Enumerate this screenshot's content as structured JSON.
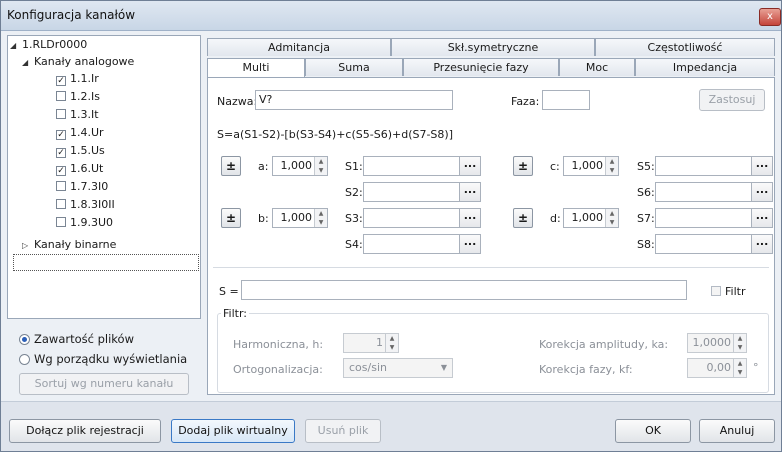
{
  "window": {
    "title": "Konfiguracja kanałów",
    "close": "x"
  },
  "tree": {
    "root": "1.RLDr0000",
    "group_analog": "Kanały analogowe",
    "channels": [
      {
        "label": "1.1.Ir",
        "checked": true
      },
      {
        "label": "1.2.Is",
        "checked": false
      },
      {
        "label": "1.3.It",
        "checked": false
      },
      {
        "label": "1.4.Ur",
        "checked": true
      },
      {
        "label": "1.5.Us",
        "checked": true
      },
      {
        "label": "1.6.Ut",
        "checked": true
      },
      {
        "label": "1.7.3I0",
        "checked": false
      },
      {
        "label": "1.8.3I0II",
        "checked": false
      },
      {
        "label": "1.9.3U0",
        "checked": false
      }
    ],
    "group_binary": "Kanały binarne"
  },
  "sort": {
    "radio1": "Zawartość plików",
    "radio2": "Wg porządku wyświetlania",
    "selected": 1,
    "sort_button": "Sortuj wg numeru kanału"
  },
  "tabs": {
    "row1": [
      "Admitancja",
      "Skł.symetryczne",
      "Częstotliwość"
    ],
    "row2": [
      "Multi",
      "Suma",
      "Przesunięcie fazy",
      "Moc",
      "Impedancja"
    ],
    "active": "Multi"
  },
  "multi": {
    "name_label": "Nazwa:",
    "name_value": "V?",
    "phase_label": "Faza:",
    "phase_value": "",
    "apply_button": "Zastosuj",
    "formula": "S=a(S1-S2)-[b(S3-S4)+c(S5-S6)+d(S7-S8)]",
    "pm_symbol": "±",
    "coef_a_label": "a:",
    "coef_a_value": "1,000",
    "coef_b_label": "b:",
    "coef_b_value": "1,000",
    "coef_c_label": "c:",
    "coef_c_value": "1,000",
    "coef_d_label": "d:",
    "coef_d_value": "1,000",
    "slots": [
      "S1:",
      "S2:",
      "S3:",
      "S4:",
      "S5:",
      "S6:",
      "S7:",
      "S8:"
    ],
    "dots": "...",
    "s_label": "S =",
    "s_value": "",
    "filter_check": "Filtr",
    "filter_group": "Filtr:",
    "harm_label": "Harmoniczna, h:",
    "harm_value": "1",
    "orth_label": "Ortogonalizacja:",
    "orth_value": "cos/sin",
    "amp_label": "Korekcja amplitudy, ka:",
    "amp_value": "1,0000",
    "phase_corr_label": "Korekcja fazy, kf:",
    "phase_corr_value": "0,00",
    "degree": "°"
  },
  "footer": {
    "attach": "Dołącz plik rejestracji",
    "add_virtual": "Dodaj plik wirtualny",
    "remove": "Usuń plik",
    "ok": "OK",
    "cancel": "Anuluj"
  }
}
